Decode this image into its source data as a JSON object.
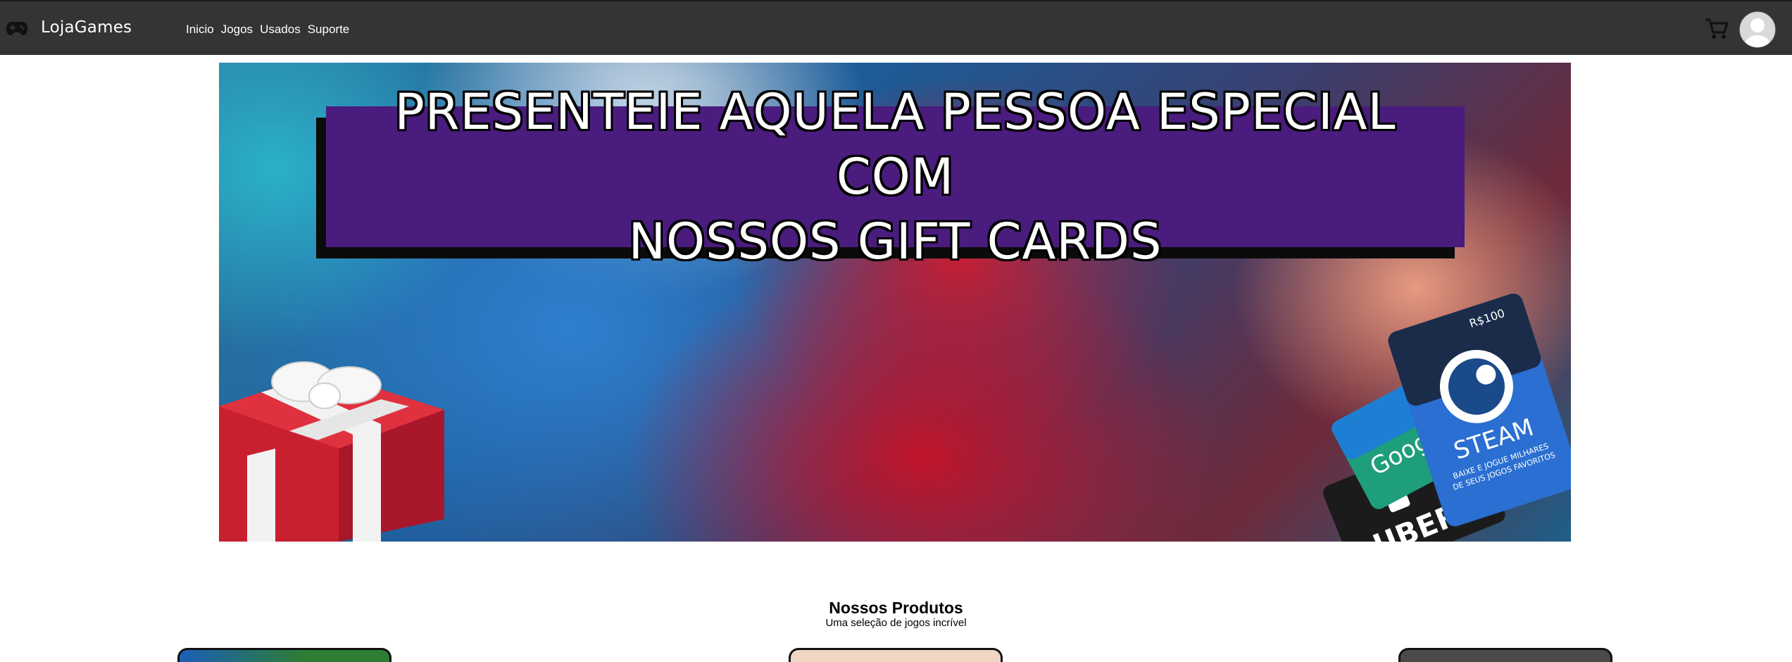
{
  "navbar": {
    "brand": "LojaGames",
    "logo_icon": "gamepad-icon",
    "links": [
      "Inicio",
      "Jogos",
      "Usados",
      "Suporte"
    ],
    "cart_icon": "shopping-cart-icon",
    "avatar_icon": "user-avatar-icon"
  },
  "hero": {
    "title_line1": "PRESENTEIE AQUELA PESSOA ESPECIAL COM",
    "title_line2": "NOSSOS GIFT CARDS",
    "gift_cards": {
      "steam_value": "R$100",
      "steam_label": "STEAM",
      "steam_sub1": "BAIXE E JOGUE MILHARES",
      "steam_sub2": "DE SEUS JOGOS FAVORITOS",
      "google_label": "Google",
      "uber_label": "UBER"
    },
    "colors": {
      "title_bg": "#4a1c7e",
      "title_shadow": "#0b0b0b"
    }
  },
  "products": {
    "title": "Nossos Produtos",
    "subtitle": "Uma seleção de jogos incrível"
  },
  "colors": {
    "navbar_bg": "#343434",
    "page_bg": "#ffffff"
  }
}
